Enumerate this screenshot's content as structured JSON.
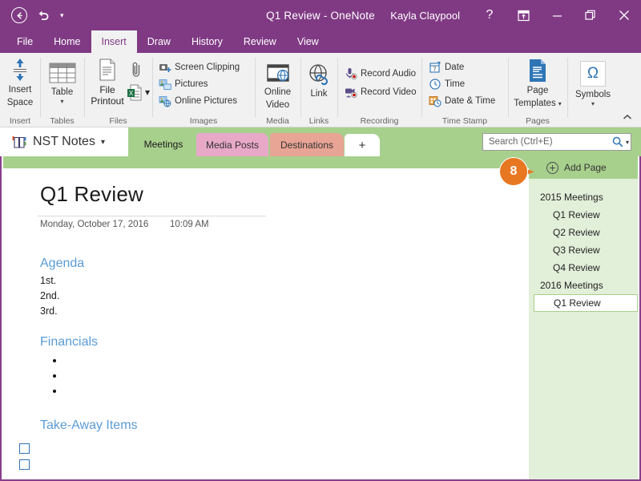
{
  "titlebar": {
    "back_icon": "back-arrow-icon",
    "undo_icon": "undo-icon",
    "customize_caret": "▾",
    "document_title": "Q1 Review - OneNote",
    "user_name": "Kayla Claypool",
    "help_label": "?",
    "ribbon_display_icon": "ribbon-display-options-icon",
    "minimize_label": "—",
    "restore_icon": "restore-icon",
    "close_label": "✕"
  },
  "ribbon_tabs": [
    {
      "label": "File",
      "active": false
    },
    {
      "label": "Home",
      "active": false
    },
    {
      "label": "Insert",
      "active": true
    },
    {
      "label": "Draw",
      "active": false
    },
    {
      "label": "History",
      "active": false
    },
    {
      "label": "Review",
      "active": false
    },
    {
      "label": "View",
      "active": false
    }
  ],
  "ribbon": {
    "collapse_icon": "collapse-ribbon-caret-icon",
    "groups": {
      "insert": {
        "label": "Insert",
        "button": {
          "line1": "Insert",
          "line2": "Space",
          "icon": "insert-space-icon"
        }
      },
      "tables": {
        "label": "Tables",
        "button": {
          "line1": "Table",
          "caret": "▾",
          "icon": "table-icon"
        }
      },
      "files": {
        "label": "Files",
        "printout": {
          "line1": "File",
          "line2": "Printout",
          "icon": "file-printout-icon"
        },
        "attach": {
          "icon": "paperclip-icon"
        },
        "spreadsheet": {
          "icon": "excel-spreadsheet-icon",
          "caret": "▾"
        }
      },
      "images": {
        "label": "Images",
        "items": [
          {
            "label": "Screen Clipping",
            "icon": "screen-clipping-icon"
          },
          {
            "label": "Pictures",
            "icon": "pictures-icon"
          },
          {
            "label": "Online Pictures",
            "icon": "online-pictures-icon"
          }
        ]
      },
      "media": {
        "label": "Media",
        "button": {
          "line1": "Online",
          "line2": "Video",
          "icon": "online-video-icon"
        }
      },
      "links": {
        "label": "Links",
        "button": {
          "line1": "Link",
          "icon": "link-icon"
        }
      },
      "recording": {
        "label": "Recording",
        "items": [
          {
            "label": "Record Audio",
            "icon": "record-audio-icon"
          },
          {
            "label": "Record Video",
            "icon": "record-video-icon"
          }
        ]
      },
      "timestamp": {
        "label": "Time Stamp",
        "items": [
          {
            "label": "Date",
            "icon": "calendar-icon"
          },
          {
            "label": "Time",
            "icon": "clock-icon"
          },
          {
            "label": "Date & Time",
            "icon": "date-time-icon"
          }
        ]
      },
      "pages": {
        "label": "Pages",
        "button": {
          "line1": "Page",
          "line2": "Templates",
          "caret": "▾",
          "icon": "page-templates-icon"
        }
      },
      "symbols": {
        "label": "",
        "button": {
          "line1": "Symbols",
          "caret": "▾",
          "icon": "omega-symbol-icon",
          "glyph": "Ω"
        }
      }
    }
  },
  "notebook_bar": {
    "notebook_icon": "notebook-icon",
    "notebook_name": "NST Notes",
    "notebook_caret": "▾",
    "sections": [
      {
        "label": "Meetings",
        "active": true,
        "color": "#A8D08D"
      },
      {
        "label": "Media Posts",
        "active": false,
        "color": "#E8A8C8"
      },
      {
        "label": "Destinations",
        "active": false,
        "color": "#E8A494"
      }
    ],
    "add_section_label": "+",
    "search": {
      "placeholder": "Search (Ctrl+E)",
      "value": "",
      "icon": "search-icon",
      "caret": "▾"
    }
  },
  "page": {
    "title": "Q1 Review",
    "date": "Monday, October 17, 2016",
    "time": "10:09 AM",
    "sections": [
      {
        "heading": "Agenda",
        "lines": [
          "1st.",
          "2nd.",
          "3rd."
        ]
      },
      {
        "heading": "Financials",
        "bullets": [
          "",
          "",
          ""
        ]
      },
      {
        "heading": "Take-Away Items",
        "checkboxes": [
          "",
          ""
        ]
      }
    ]
  },
  "page_pane": {
    "add_page_label": "Add Page",
    "add_page_icon": "add-page-plus-icon",
    "pages": [
      {
        "label": "2015 Meetings",
        "level": 0,
        "selected": false
      },
      {
        "label": "Q1 Review",
        "level": 1,
        "selected": false
      },
      {
        "label": "Q2 Review",
        "level": 1,
        "selected": false
      },
      {
        "label": "Q3 Review",
        "level": 1,
        "selected": false
      },
      {
        "label": "Q4 Review",
        "level": 1,
        "selected": false
      },
      {
        "label": "2016 Meetings",
        "level": 0,
        "selected": false
      },
      {
        "label": "Q1 Review",
        "level": 1,
        "selected": true
      }
    ]
  },
  "callout": {
    "number": "8",
    "color": "#E87722"
  },
  "colors": {
    "accent_purple": "#803A84",
    "border_purple": "#873E8B",
    "section_green": "#A8D08D",
    "pane_green": "#E2EFD9",
    "heading_blue": "#5B9BD5",
    "callout_orange": "#E87722"
  }
}
